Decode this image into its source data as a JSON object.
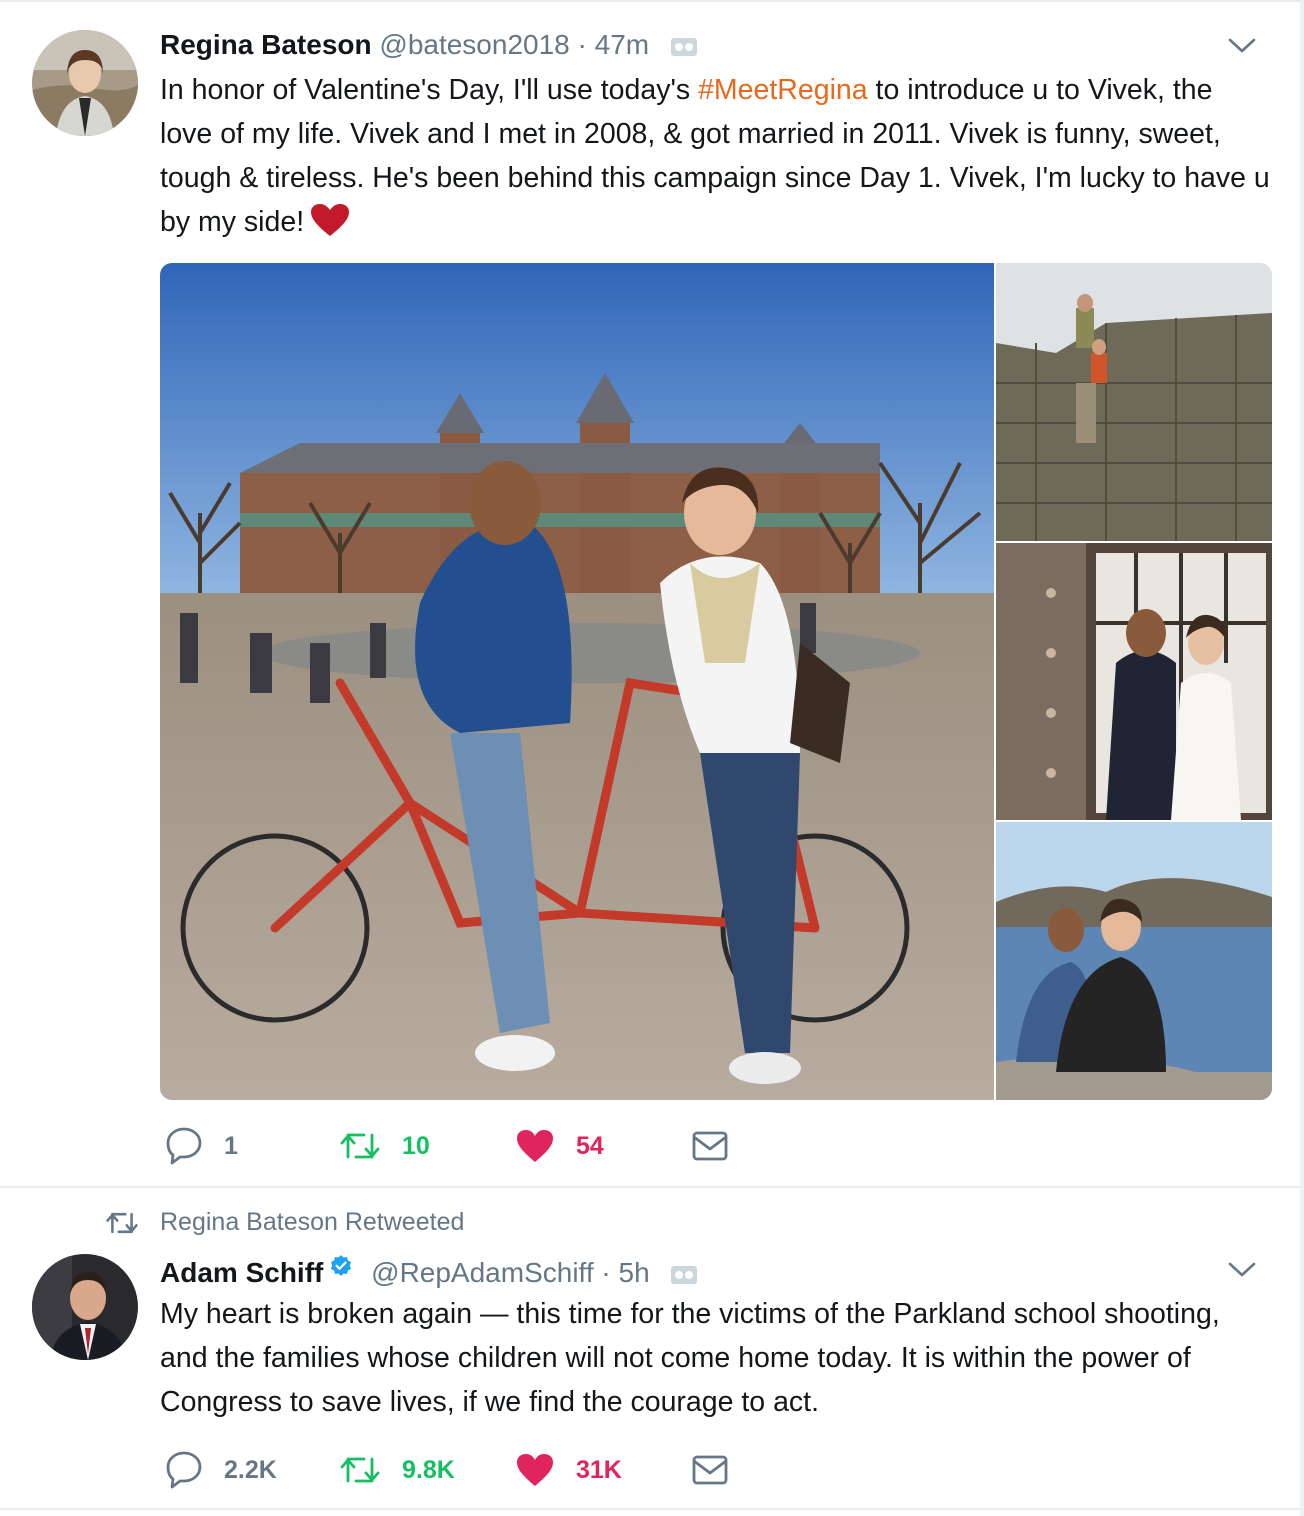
{
  "tweet1": {
    "name": "Regina Bateson",
    "handle": "@bateson2018",
    "separator": "·",
    "time": "47m",
    "text_part1": "In honor of Valentine's Day, I'll use today's ",
    "hashtag": "#MeetRegina",
    "text_part2": " to introduce u to Vivek, the love of my life. Vivek and I met in 2008, & got married in 2011. Vivek is funny, sweet, tough & tireless. He's been behind this campaign since Day 1. Vivek, I'm lucky to have u by my side!",
    "counts": {
      "replies": "1",
      "retweets": "10",
      "likes": "54"
    }
  },
  "retweet_context": {
    "label": "Regina Bateson Retweeted"
  },
  "tweet2": {
    "name": "Adam Schiff",
    "handle": "@RepAdamSchiff",
    "separator": "·",
    "time": "5h",
    "text": "My heart is broken again — this time for the victims of the Parkland school shooting, and the families whose children will not come home today. It is within the power of Congress to save lives, if we find the courage to act.",
    "counts": {
      "replies": "2.2K",
      "retweets": "9.8K",
      "likes": "31K"
    }
  },
  "icons": {
    "reply": "reply-icon",
    "retweet": "retweet-icon",
    "like": "heart-icon",
    "message": "envelope-icon",
    "more": "chevron-down-icon",
    "verified": "verified-badge-icon",
    "translate": "camera-icon"
  },
  "colors": {
    "hashtag": "#e8691e",
    "retweet": "#17bf63",
    "like": "#e0245e",
    "muted": "#657786",
    "verified": "#1da1f2"
  }
}
